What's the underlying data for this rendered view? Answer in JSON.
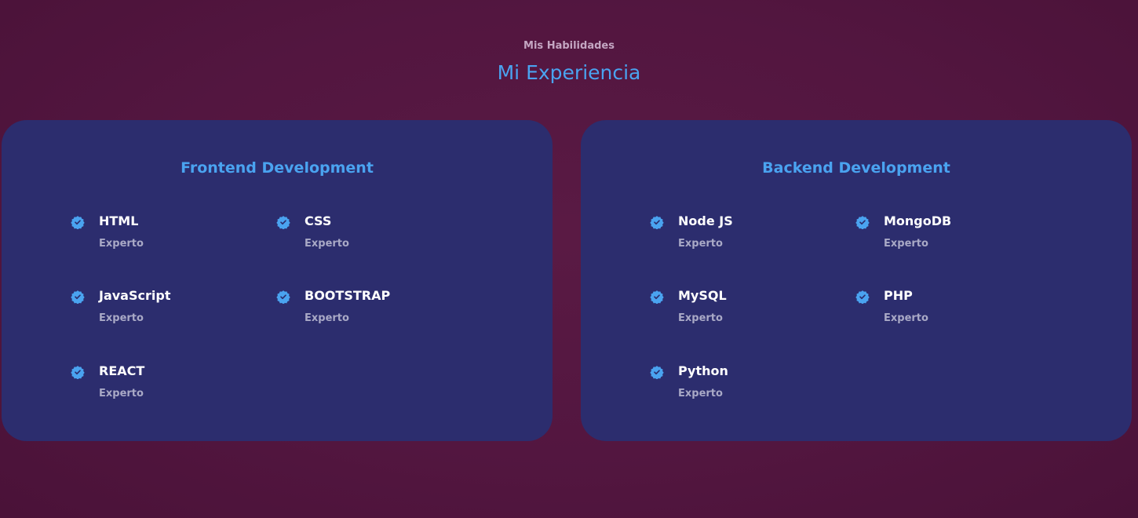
{
  "header": {
    "subtitle": "Mis Habilidades",
    "title": "Mi Experiencia"
  },
  "colors": {
    "accent": "#4aa3f0",
    "card": "#2c2d6e",
    "background": "#531640"
  },
  "frontend": {
    "title": "Frontend Development",
    "skills": [
      {
        "name": "HTML",
        "level": "Experto",
        "icon": "verified-badge-icon"
      },
      {
        "name": "CSS",
        "level": "Experto",
        "icon": "verified-badge-icon"
      },
      {
        "name": "JavaScript",
        "level": "Experto",
        "icon": "verified-badge-icon"
      },
      {
        "name": "BOOTSTRAP",
        "level": "Experto",
        "icon": "verified-badge-icon"
      },
      {
        "name": "REACT",
        "level": "Experto",
        "icon": "verified-badge-icon"
      }
    ]
  },
  "backend": {
    "title": "Backend Development",
    "skills": [
      {
        "name": "Node JS",
        "level": "Experto",
        "icon": "verified-badge-icon"
      },
      {
        "name": "MongoDB",
        "level": "Experto",
        "icon": "verified-badge-icon"
      },
      {
        "name": "MySQL",
        "level": "Experto",
        "icon": "verified-badge-icon"
      },
      {
        "name": "PHP",
        "level": "Experto",
        "icon": "verified-badge-icon"
      },
      {
        "name": "Python",
        "level": "Experto",
        "icon": "verified-badge-icon"
      }
    ]
  }
}
